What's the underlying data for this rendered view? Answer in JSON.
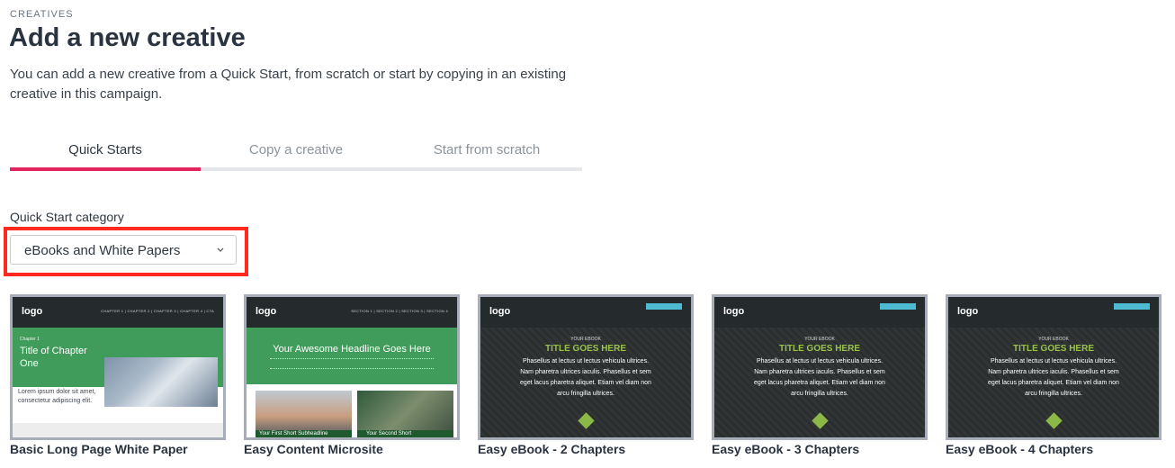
{
  "header": {
    "eyebrow": "CREATIVES",
    "title": "Add a new creative",
    "subtitle": "You can add a new creative from a Quick Start, from scratch or start by copying in an existing creative in this campaign."
  },
  "tabs": [
    {
      "label": "Quick Starts",
      "active": true
    },
    {
      "label": "Copy a creative",
      "active": false
    },
    {
      "label": "Start from scratch",
      "active": false
    }
  ],
  "category": {
    "label": "Quick Start category",
    "selected": "eBooks and White Papers"
  },
  "colors": {
    "accent": "#e0245e",
    "highlight": "#ff2a1f",
    "template_green": "#409c5a",
    "ebook_green": "#98c24a"
  },
  "templates": [
    {
      "name": "Basic Long Page White Paper",
      "thumb": {
        "logo": "logo",
        "nav": "CHAPTER 1 | CHAPTER 2 | CHAPTER 3 | CHAPTER 4 | CTA",
        "chapter": "Chapter 1",
        "heading": "Title of Chapter One",
        "body": "Lorem ipsum dolor sit amet, consectetur adipiscing elit."
      }
    },
    {
      "name": "Easy Content Microsite",
      "thumb": {
        "logo": "logo",
        "nav": "SECTION 1 | SECTION 2 | SECTION 3 | SECTION 4",
        "headline": "Your Awesome Headline Goes Here",
        "sub1": "Your First Short Subheadline",
        "sub2": "Your Second Short"
      }
    },
    {
      "name": "Easy eBook - 2 Chapters",
      "thumb": {
        "logo": "logo",
        "eyebrow": "YOUR EBOOK",
        "heading": "TITLE GOES HERE",
        "body": "Phasellus at lectus ut lectus vehicula ultrices. Nam pharetra ultrices iaculis. Phasellus et sem eget lacus pharetra aliquet. Etiam vel diam non arcu fringilla ultrices."
      }
    },
    {
      "name": "Easy eBook - 3 Chapters",
      "thumb": {
        "logo": "logo",
        "eyebrow": "YOUR EBOOK",
        "heading": "TITLE GOES HERE",
        "body": "Phasellus at lectus ut lectus vehicula ultrices. Nam pharetra ultrices iaculis. Phasellus et sem eget lacus pharetra aliquet. Etiam vel diam non arcu fringilla ultrices."
      }
    },
    {
      "name": "Easy eBook - 4 Chapters",
      "thumb": {
        "logo": "logo",
        "eyebrow": "YOUR EBOOK",
        "heading": "TITLE GOES HERE",
        "body": "Phasellus at lectus ut lectus vehicula ultrices. Nam pharetra ultrices iaculis. Phasellus et sem eget lacus pharetra aliquet. Etiam vel diam non arcu fringilla ultrices."
      }
    }
  ]
}
